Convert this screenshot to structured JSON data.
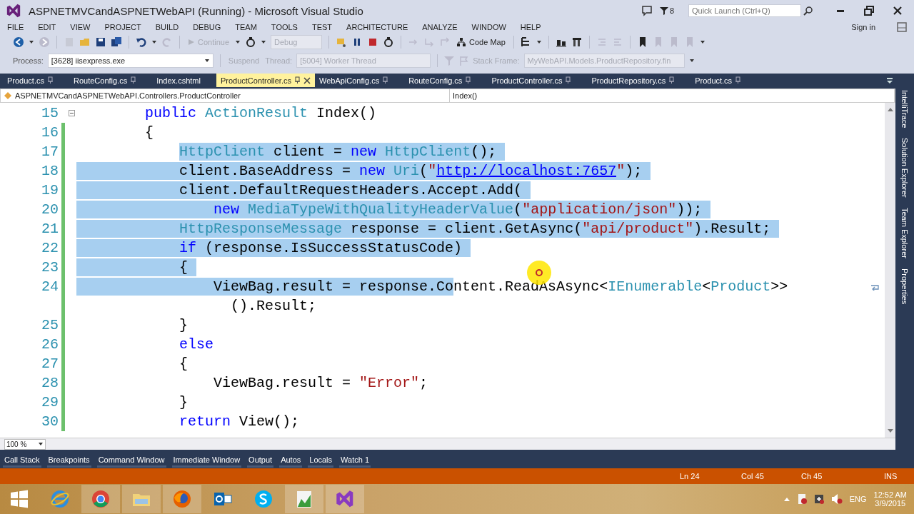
{
  "window": {
    "title": "ASPNETMVCandASPNETWebAPI (Running) - Microsoft Visual Studio",
    "notification_count": "8",
    "quick_launch": {
      "placeholder": "Quick Launch (Ctrl+Q)"
    }
  },
  "menu": {
    "items": [
      "FILE",
      "EDIT",
      "VIEW",
      "PROJECT",
      "BUILD",
      "DEBUG",
      "TEAM",
      "TOOLS",
      "TEST",
      "ARCHITECTURE",
      "ANALYZE",
      "WINDOW",
      "HELP"
    ],
    "sign_in": "Sign in"
  },
  "toolbar": {
    "continue": {
      "label": "Continue",
      "disabled": true
    },
    "configuration": {
      "value": "Debug",
      "disabled": true
    },
    "code_map": {
      "label": "Code Map",
      "disabled": false
    }
  },
  "debug_location": {
    "process_label": "Process:",
    "process": {
      "value": "[3628] iisexpress.exe",
      "disabled": false
    },
    "suspend": {
      "label": "Suspend",
      "disabled": true
    },
    "thread_label": "Thread:",
    "thread": {
      "value": "[5004] Worker Thread",
      "disabled": true
    },
    "stack_frame_label": "Stack Frame:",
    "stack_frame": {
      "value": "MyWebAPI.Models.ProductRepository.fin",
      "disabled": true
    }
  },
  "tabs": [
    {
      "label": "Product.cs",
      "selected": false,
      "pinned": true
    },
    {
      "label": "RouteConfig.cs",
      "selected": false,
      "pinned": true
    },
    {
      "label": "Index.cshtml",
      "selected": false,
      "pinned": false
    },
    {
      "label": "ProductController.cs",
      "selected": true,
      "pinned": true
    },
    {
      "label": "WebApiConfig.cs",
      "selected": false,
      "pinned": true
    },
    {
      "label": "RouteConfig.cs",
      "selected": false,
      "pinned": true
    },
    {
      "label": "ProductController.cs",
      "selected": false,
      "pinned": true
    },
    {
      "label": "ProductRepository.cs",
      "selected": false,
      "pinned": true
    },
    {
      "label": "Product.cs",
      "selected": false,
      "pinned": true
    }
  ],
  "navigation": {
    "type_scope": "ASPNETMVCandASPNETWebAPI.Controllers.ProductController",
    "member": "Index()"
  },
  "editor": {
    "lines": [
      {
        "number": "15",
        "changed": false,
        "collapsible": true,
        "indent_selected": false,
        "selected_eol": false,
        "wrapped": false,
        "tokens": [
          {
            "text": "        public",
            "kind": "keyword",
            "selected": false
          },
          {
            "text": " ActionResult",
            "kind": "type",
            "selected": false
          },
          {
            "text": " Index()",
            "kind": "plain",
            "selected": false
          }
        ]
      },
      {
        "number": "16",
        "changed": true,
        "collapsible": false,
        "indent_selected": false,
        "selected_eol": false,
        "wrapped": false,
        "tokens": [
          {
            "text": "        {",
            "kind": "plain",
            "selected": false
          }
        ]
      },
      {
        "number": "17",
        "changed": true,
        "collapsible": false,
        "indent_selected": false,
        "selected_eol": true,
        "wrapped": false,
        "tokens": [
          {
            "text": "            HttpClient",
            "kind": "type",
            "selected": true
          },
          {
            "text": " client = ",
            "kind": "plain",
            "selected": true
          },
          {
            "text": "new",
            "kind": "keyword",
            "selected": true
          },
          {
            "text": " HttpClient",
            "kind": "type",
            "selected": true
          },
          {
            "text": "();",
            "kind": "plain",
            "selected": true
          }
        ]
      },
      {
        "number": "18",
        "changed": true,
        "collapsible": false,
        "indent_selected": true,
        "selected_eol": true,
        "wrapped": false,
        "tokens": [
          {
            "text": "            client.BaseAddress = ",
            "kind": "plain",
            "selected": true
          },
          {
            "text": "new",
            "kind": "keyword",
            "selected": true
          },
          {
            "text": " Uri",
            "kind": "type",
            "selected": true
          },
          {
            "text": "(",
            "kind": "plain",
            "selected": true
          },
          {
            "text": "\"",
            "kind": "string",
            "selected": true
          },
          {
            "text": "http://localhost:7657",
            "kind": "link",
            "selected": true
          },
          {
            "text": "\"",
            "kind": "string",
            "selected": true
          },
          {
            "text": ");",
            "kind": "plain",
            "selected": true
          }
        ]
      },
      {
        "number": "19",
        "changed": true,
        "collapsible": false,
        "indent_selected": true,
        "selected_eol": true,
        "wrapped": false,
        "tokens": [
          {
            "text": "            client.DefaultRequestHeaders.Accept.Add(",
            "kind": "plain",
            "selected": true
          }
        ]
      },
      {
        "number": "20",
        "changed": true,
        "collapsible": false,
        "indent_selected": true,
        "selected_eol": true,
        "wrapped": false,
        "tokens": [
          {
            "text": "                new",
            "kind": "keyword",
            "selected": true
          },
          {
            "text": " MediaTypeWithQualityHeaderValue",
            "kind": "type",
            "selected": true
          },
          {
            "text": "(",
            "kind": "plain",
            "selected": true
          },
          {
            "text": "\"application/json\"",
            "kind": "string",
            "selected": true
          },
          {
            "text": "));",
            "kind": "plain",
            "selected": true
          }
        ]
      },
      {
        "number": "21",
        "changed": true,
        "collapsible": false,
        "indent_selected": true,
        "selected_eol": true,
        "wrapped": false,
        "tokens": [
          {
            "text": "            HttpResponseMessage",
            "kind": "type",
            "selected": true
          },
          {
            "text": " response = client.GetAsync(",
            "kind": "plain",
            "selected": true
          },
          {
            "text": "\"api/product\"",
            "kind": "string",
            "selected": true
          },
          {
            "text": ").Result;",
            "kind": "plain",
            "selected": true
          }
        ]
      },
      {
        "number": "22",
        "changed": true,
        "collapsible": false,
        "indent_selected": true,
        "selected_eol": true,
        "wrapped": false,
        "tokens": [
          {
            "text": "            if",
            "kind": "keyword",
            "selected": true
          },
          {
            "text": " (response.IsSuccessStatusCode)",
            "kind": "plain",
            "selected": true
          }
        ]
      },
      {
        "number": "23",
        "changed": true,
        "collapsible": false,
        "indent_selected": true,
        "selected_eol": true,
        "wrapped": false,
        "tokens": [
          {
            "text": "            {",
            "kind": "plain",
            "selected": true
          }
        ]
      },
      {
        "number": "24",
        "changed": true,
        "collapsible": false,
        "indent_selected": true,
        "selected_eol": false,
        "wrapped": true,
        "tokens": [
          {
            "text": "                ViewBag.result = response.Co",
            "kind": "plain",
            "selected": true
          },
          {
            "text": "ntent.ReadAsAsync<",
            "kind": "plain",
            "selected": false
          },
          {
            "text": "IEnumerable",
            "kind": "type",
            "selected": false
          },
          {
            "text": "<",
            "kind": "plain",
            "selected": false
          },
          {
            "text": "Product",
            "kind": "type",
            "selected": false
          },
          {
            "text": ">>",
            "kind": "plain",
            "selected": false
          }
        ],
        "continuation": [
          {
            "text": "                  ().Result;",
            "kind": "plain",
            "selected": false
          }
        ]
      },
      {
        "number": "25",
        "changed": true,
        "collapsible": false,
        "indent_selected": false,
        "selected_eol": false,
        "wrapped": false,
        "tokens": [
          {
            "text": "            }",
            "kind": "plain",
            "selected": false
          }
        ]
      },
      {
        "number": "26",
        "changed": true,
        "collapsible": false,
        "indent_selected": false,
        "selected_eol": false,
        "wrapped": false,
        "tokens": [
          {
            "text": "            else",
            "kind": "keyword",
            "selected": false
          }
        ]
      },
      {
        "number": "27",
        "changed": true,
        "collapsible": false,
        "indent_selected": false,
        "selected_eol": false,
        "wrapped": false,
        "tokens": [
          {
            "text": "            {",
            "kind": "plain",
            "selected": false
          }
        ]
      },
      {
        "number": "28",
        "changed": true,
        "collapsible": false,
        "indent_selected": false,
        "selected_eol": false,
        "wrapped": false,
        "tokens": [
          {
            "text": "                ViewBag.result = ",
            "kind": "plain",
            "selected": false
          },
          {
            "text": "\"Error\"",
            "kind": "string",
            "selected": false
          },
          {
            "text": ";",
            "kind": "plain",
            "selected": false
          }
        ]
      },
      {
        "number": "29",
        "changed": true,
        "collapsible": false,
        "indent_selected": false,
        "selected_eol": false,
        "wrapped": false,
        "tokens": [
          {
            "text": "            }",
            "kind": "plain",
            "selected": false
          }
        ]
      },
      {
        "number": "30",
        "changed": true,
        "collapsible": false,
        "indent_selected": false,
        "selected_eol": false,
        "wrapped": false,
        "tokens": [
          {
            "text": "            return",
            "kind": "keyword",
            "selected": false
          },
          {
            "text": " View();",
            "kind": "plain",
            "selected": false
          }
        ]
      }
    ],
    "zoom": "100 %"
  },
  "side_tabs": [
    "IntelliTrace",
    "Solution Explorer",
    "Team Explorer",
    "Properties"
  ],
  "tool_tabs": [
    "Call Stack",
    "Breakpoints",
    "Command Window",
    "Immediate Window",
    "Output",
    "Autos",
    "Locals",
    "Watch 1"
  ],
  "status_bar": {
    "line": "Ln 24",
    "column": "Col 45",
    "char": "Ch 45",
    "mode": "INS"
  },
  "taskbar": {
    "apps": [
      {
        "kind": "ie",
        "running": false
      },
      {
        "kind": "chrome",
        "running": true
      },
      {
        "kind": "explorer",
        "running": true
      },
      {
        "kind": "firefox",
        "running": true
      },
      {
        "kind": "outlook",
        "running": false
      },
      {
        "kind": "skype",
        "running": false
      },
      {
        "kind": "image",
        "running": true
      },
      {
        "kind": "vs",
        "running": true
      }
    ],
    "language": "ENG",
    "time": "12:52 AM",
    "date": "3/9/2015"
  }
}
